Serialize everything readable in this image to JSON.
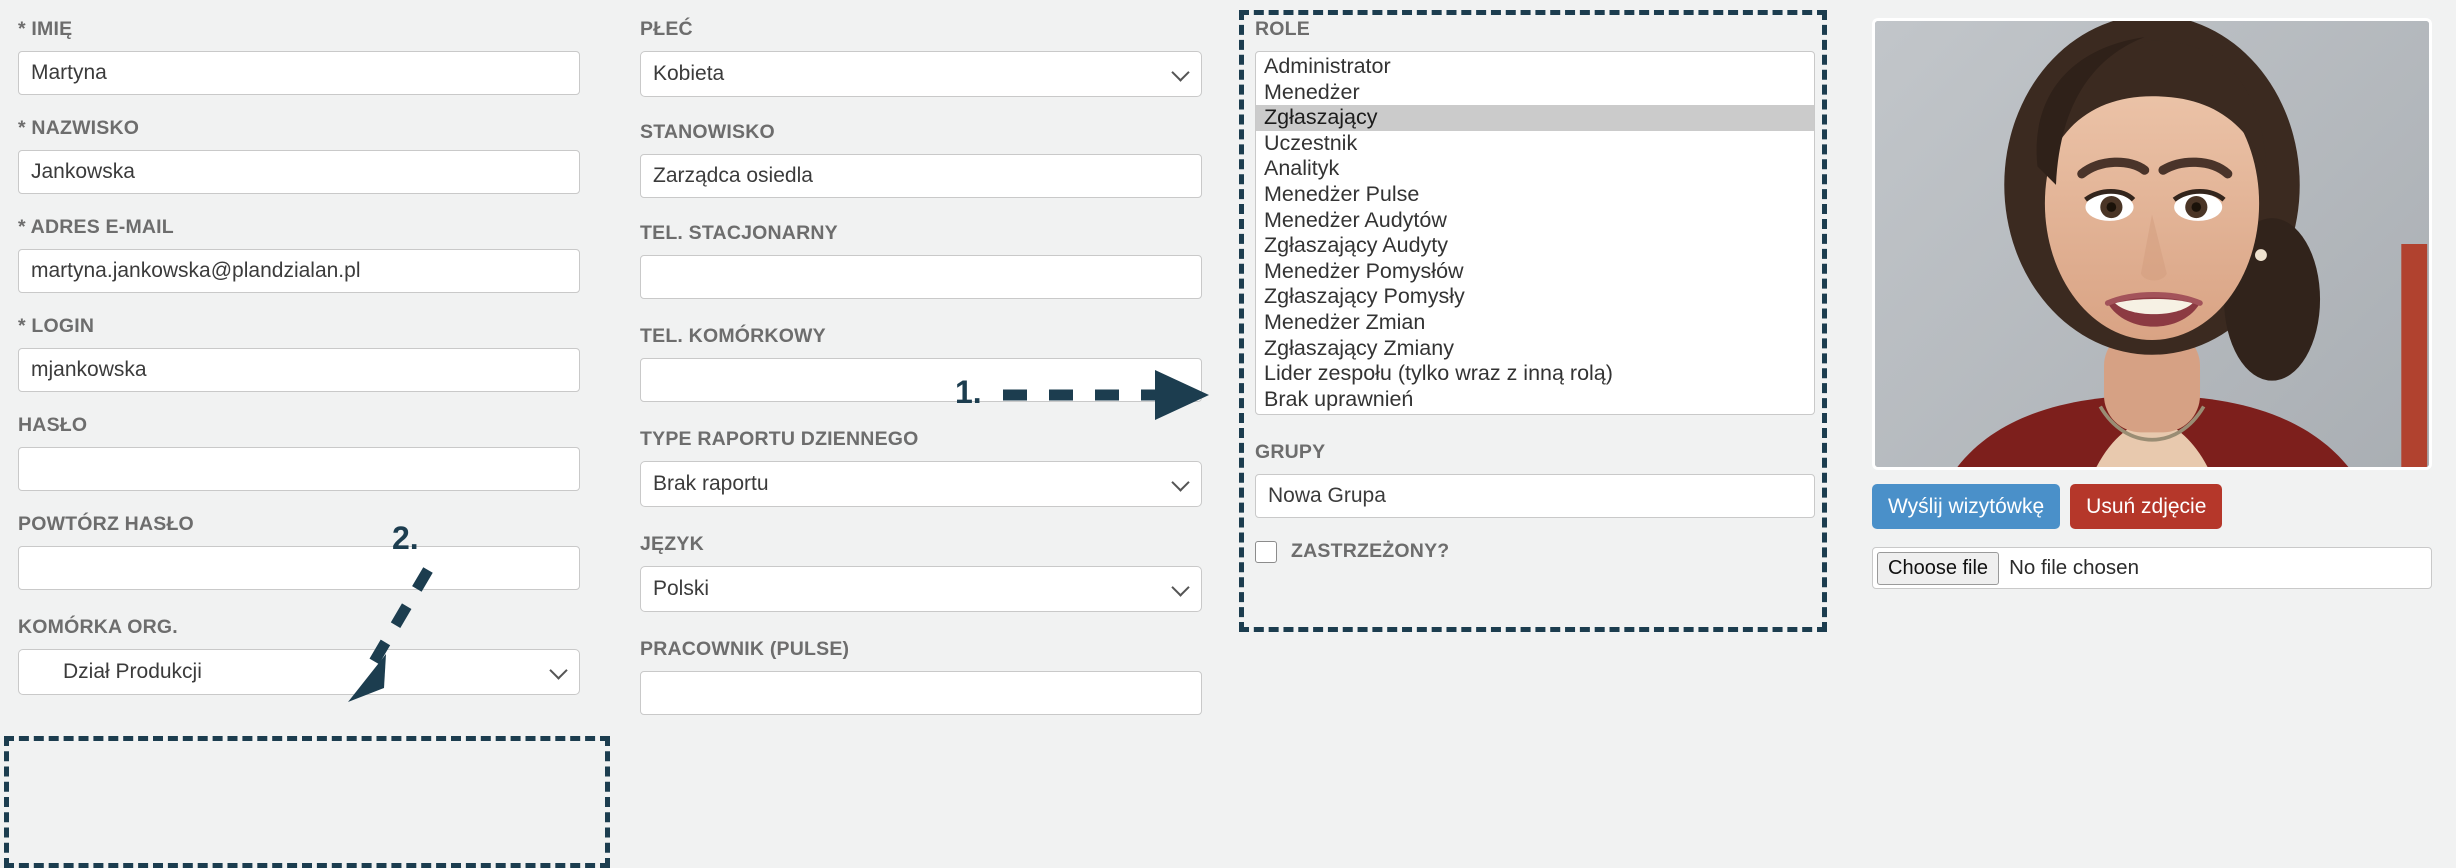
{
  "colors": {
    "page_bg": "#f1f2f2",
    "label": "#6d6d6d",
    "annotation": "#1c3d4f",
    "send_button": "#4a90c9",
    "delete_button": "#b5372a",
    "selected_row": "#cbcbcb"
  },
  "column_personal": {
    "first_name": {
      "label": "* IMIĘ",
      "value": "Martyna"
    },
    "last_name": {
      "label": "* NAZWISKO",
      "value": "Jankowska"
    },
    "email": {
      "label": "* ADRES E-MAIL",
      "value": "martyna.jankowska@plandzialan.pl"
    },
    "login": {
      "label": "* LOGIN",
      "value": "mjankowska"
    },
    "password": {
      "label": "HASŁO",
      "value": ""
    },
    "password_repeat": {
      "label": "POWTÓRZ HASŁO",
      "value": ""
    },
    "org_unit": {
      "label": "KOMÓRKA ORG.",
      "value": "Dział Produkcji"
    }
  },
  "column_details": {
    "gender": {
      "label": "PŁEĆ",
      "value": "Kobieta"
    },
    "position": {
      "label": "STANOWISKO",
      "value": "Zarządca osiedla"
    },
    "phone_landline": {
      "label": "TEL. STACJONARNY",
      "value": ""
    },
    "phone_mobile": {
      "label": "TEL. KOMÓRKOWY",
      "value": ""
    },
    "daily_report_type": {
      "label": "TYPE RAPORTU DZIENNEGO",
      "value": "Brak raportu"
    },
    "language": {
      "label": "JĘZYK",
      "value": "Polski"
    },
    "employee_pulse": {
      "label": "PRACOWNIK (PULSE)",
      "value": ""
    }
  },
  "column_roles": {
    "roles": {
      "label": "ROLE",
      "selected": "Zgłaszający",
      "options": [
        "Administrator",
        "Menedżer",
        "Zgłaszający",
        "Uczestnik",
        "Analityk",
        "Menedżer Pulse",
        "Menedżer Audytów",
        "Zgłaszający Audyty",
        "Menedżer Pomysłów",
        "Zgłaszający Pomysły",
        "Menedżer Zmian",
        "Zgłaszający Zmiany",
        "Lider zespołu (tylko wraz z inną rolą)",
        "Brak uprawnień"
      ]
    },
    "groups": {
      "label": "GRUPY",
      "value": "Nowa Grupa"
    },
    "restricted": {
      "label": "ZASTRZEŻONY?",
      "checked": false
    }
  },
  "column_photo": {
    "send_card_button": "Wyślij wizytówkę",
    "delete_photo_button": "Usuń zdjęcie",
    "file_input": {
      "button_label": "Choose file",
      "status": "No file chosen"
    },
    "avatar_alt": "portrait-photo"
  },
  "annotations": {
    "step_one": "1.",
    "step_two": "2."
  }
}
